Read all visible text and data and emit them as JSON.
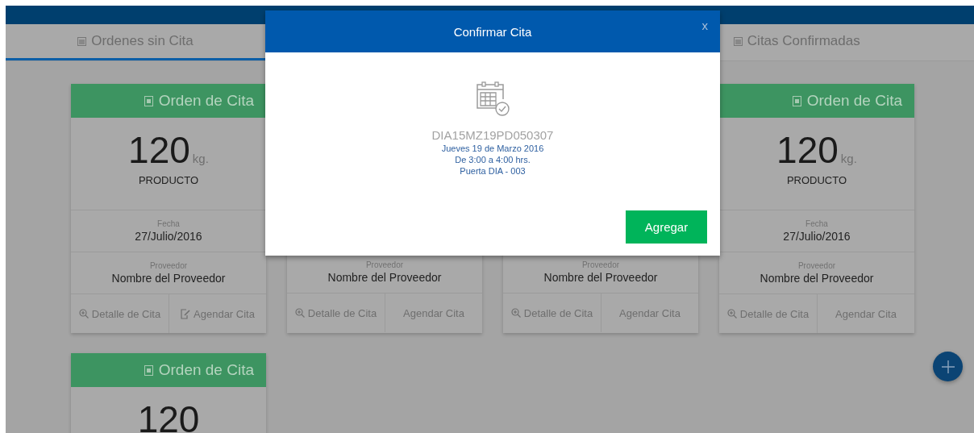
{
  "tabs": [
    {
      "label": "Ordenes sin Cita",
      "selected": true
    },
    {
      "label": "Citas Confirmadas",
      "selected": false
    }
  ],
  "cards": [
    {
      "title": "Orden de Cita",
      "quantity": "120",
      "unit": "kg.",
      "product": "PRODUCTO",
      "date_label": "Fecha",
      "date": "27/Julio/2016",
      "supplier_label": "Proveedor",
      "supplier": "Nombre del Proveedor",
      "buttons": [
        {
          "label": "Detalle de Cita",
          "icon": true
        },
        {
          "label": "Agendar Cita",
          "icon": true
        }
      ]
    },
    {
      "supplier_label": "Proveedor",
      "supplier": "Nombre del Proveedor",
      "buttons": [
        {
          "label": "Detalle de Cita",
          "icon": true
        },
        {
          "label": "Agendar Cita",
          "icon": false
        }
      ]
    },
    {
      "supplier_label": "Proveedor",
      "supplier": "Nombre del Proveedor",
      "buttons": [
        {
          "label": "Detalle de Cita",
          "icon": true
        },
        {
          "label": "Agendar Cita",
          "icon": false
        }
      ]
    },
    {
      "title": "Orden de Cita",
      "quantity": "120",
      "unit": "kg.",
      "product": "PRODUCTO",
      "date_label": "Fecha",
      "date": "27/Julio/2016",
      "supplier_label": "Proveedor",
      "supplier": "Nombre del Proveedor",
      "buttons": [
        {
          "label": "Detalle de Cita",
          "icon": true
        },
        {
          "label": "Agendar Cita",
          "icon": false
        }
      ]
    },
    {
      "title": "Orden de Cita",
      "quantity": "120"
    }
  ],
  "modal": {
    "title": "Confirmar Cita",
    "close": "x",
    "code": "DIA15MZ19PD050307",
    "details": [
      "Jueves 19 de Marzo 2016",
      "De 3:00 a 4:00 hrs.",
      "Puerta DIA - 003"
    ],
    "button": "Agregar"
  }
}
